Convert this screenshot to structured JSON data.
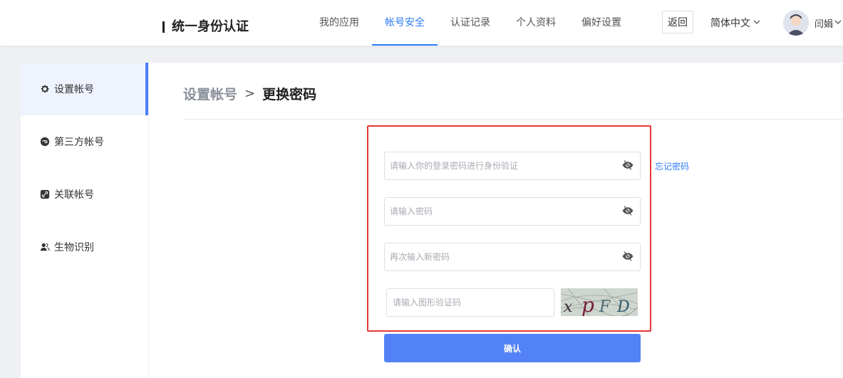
{
  "header": {
    "brand": "统一身份认证",
    "nav": [
      {
        "label": "我的应用",
        "active": false
      },
      {
        "label": "帐号安全",
        "active": true
      },
      {
        "label": "认证记录",
        "active": false
      },
      {
        "label": "个人资料",
        "active": false
      },
      {
        "label": "偏好设置",
        "active": false
      }
    ],
    "back_label": "返回",
    "language": "简体中文",
    "user_name": "闫娟"
  },
  "sidebar": {
    "items": [
      {
        "label": "设置帐号",
        "icon": "gear-icon",
        "active": true
      },
      {
        "label": "第三方帐号",
        "icon": "link-circle-icon",
        "active": false
      },
      {
        "label": "关联帐号",
        "icon": "chain-link-icon",
        "active": false
      },
      {
        "label": "生物识别",
        "icon": "user-icon",
        "active": false
      }
    ]
  },
  "main": {
    "breadcrumb_parent": "设置帐号",
    "breadcrumb_separator": ">",
    "breadcrumb_current": "更换密码",
    "form": {
      "current_password_placeholder": "请输入你的登录密码进行身份验证",
      "new_password_placeholder": "请输入密码",
      "confirm_password_placeholder": "再次输入新密码",
      "captcha_placeholder": "请输入图形验证码",
      "captcha_text": "xpFD",
      "forgot_password_label": "忘记密码",
      "submit_label": "确认"
    }
  },
  "colors": {
    "accent": "#2d7cf6",
    "button": "#5382f6",
    "highlight_border": "#e53935",
    "sidebar_active_bg": "#eef3fd"
  }
}
